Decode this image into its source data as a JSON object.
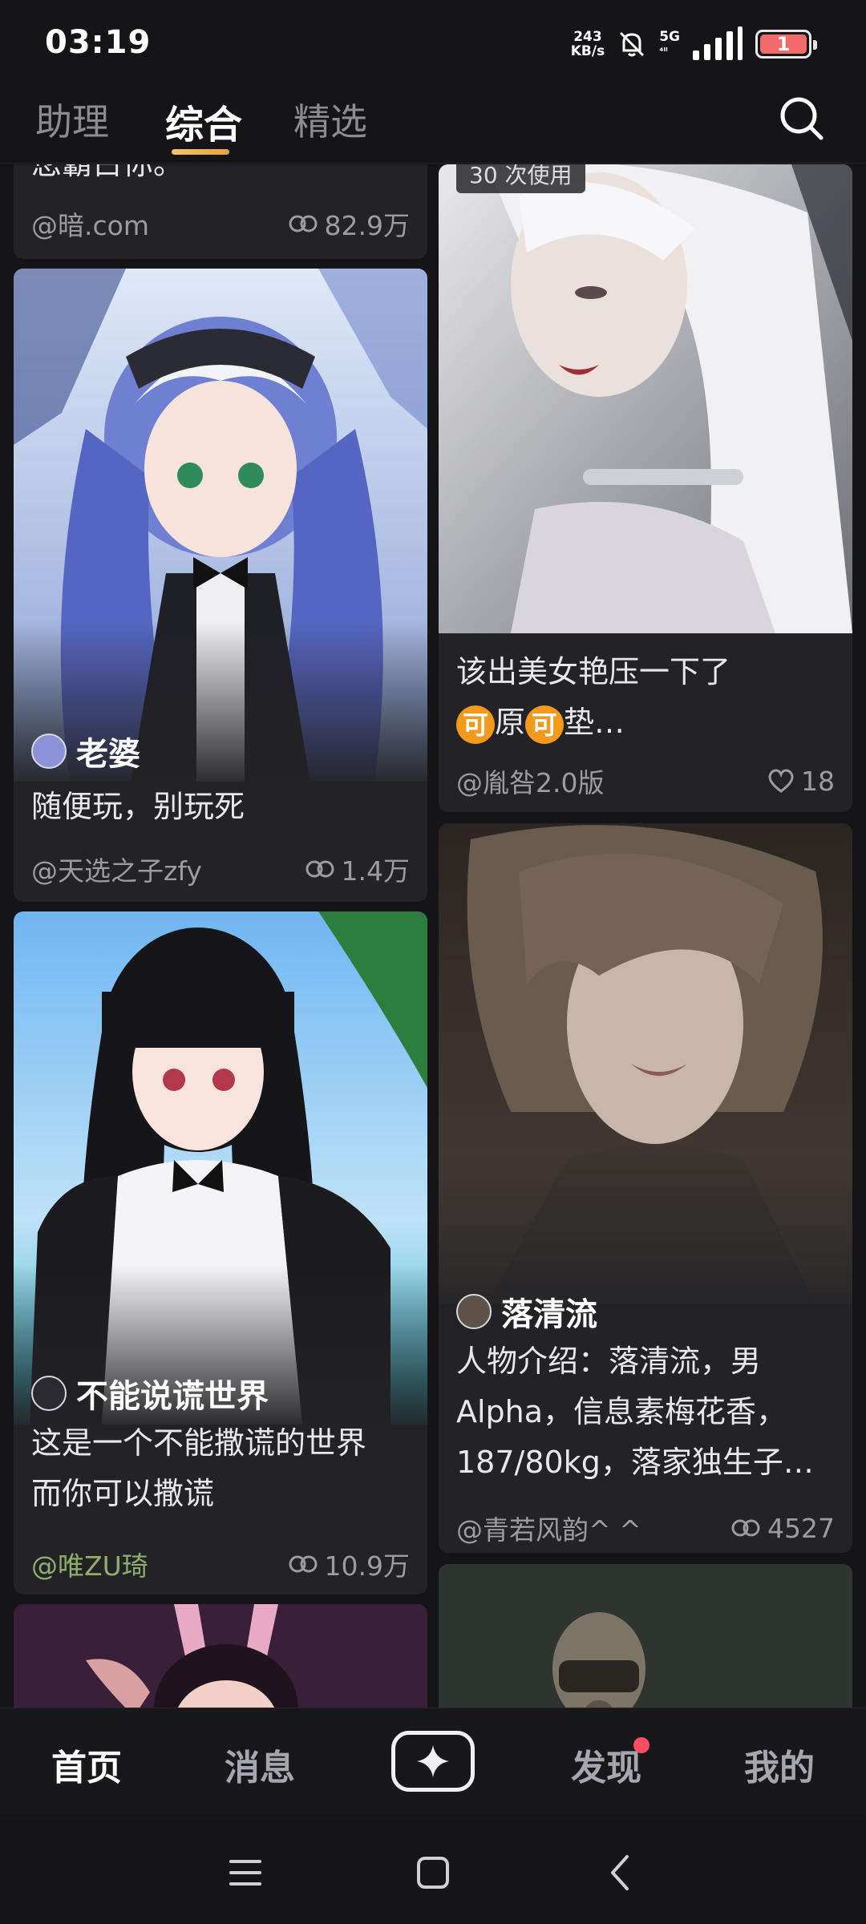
{
  "status_bar": {
    "time": "03:19",
    "net_speed_value": "243",
    "net_speed_unit": "KB/s",
    "network": "5G",
    "network_sub": "⁴ˡˡ",
    "battery": "1"
  },
  "tabs": [
    {
      "label": "助理",
      "active": false
    },
    {
      "label": "综合",
      "active": true
    },
    {
      "label": "精选",
      "active": false
    }
  ],
  "feed": {
    "left": [
      {
        "desc": "您霸占你。",
        "author": "@暗.com",
        "count": "82.9万",
        "count_icon": "eye-icon"
      },
      {
        "character": "老婆",
        "desc": "随便玩，别玩死",
        "author": "@天选之子zfy",
        "count": "1.4万",
        "count_icon": "eye-icon"
      },
      {
        "character": "不能说谎世界",
        "desc_line1": "这是一个不能撒谎的世界",
        "desc_line2": "而你可以撒谎",
        "author": "@唯ZU琦",
        "count": "10.9万",
        "count_icon": "eye-icon"
      }
    ],
    "right": [
      {
        "badge": "30 次使用",
        "desc_line1": "该出美女艳压一下了",
        "desc_emoji1": "可",
        "desc_mid": "原",
        "desc_emoji2": "可",
        "desc_tail": "垫…",
        "author": "@胤咎2.0版",
        "count": "18",
        "count_icon": "heart-icon"
      },
      {
        "character": "落清流",
        "desc_line1": "人物介绍：落清流，男",
        "desc_line2": "Alpha，信息素梅花香，",
        "desc_line3": "187/80kg，落家独生子…",
        "author": "@青若风韵^ ^",
        "count": "4527",
        "count_icon": "eye-icon"
      }
    ]
  },
  "bottom_nav": {
    "home": "首页",
    "messages": "消息",
    "create_icon": "sparkle-plus-icon",
    "discover": "发现",
    "me": "我的"
  },
  "colors": {
    "background": "#151517",
    "card": "#232326",
    "accent_underline": "#e6a33e",
    "notification_dot": "#ff4d62"
  }
}
